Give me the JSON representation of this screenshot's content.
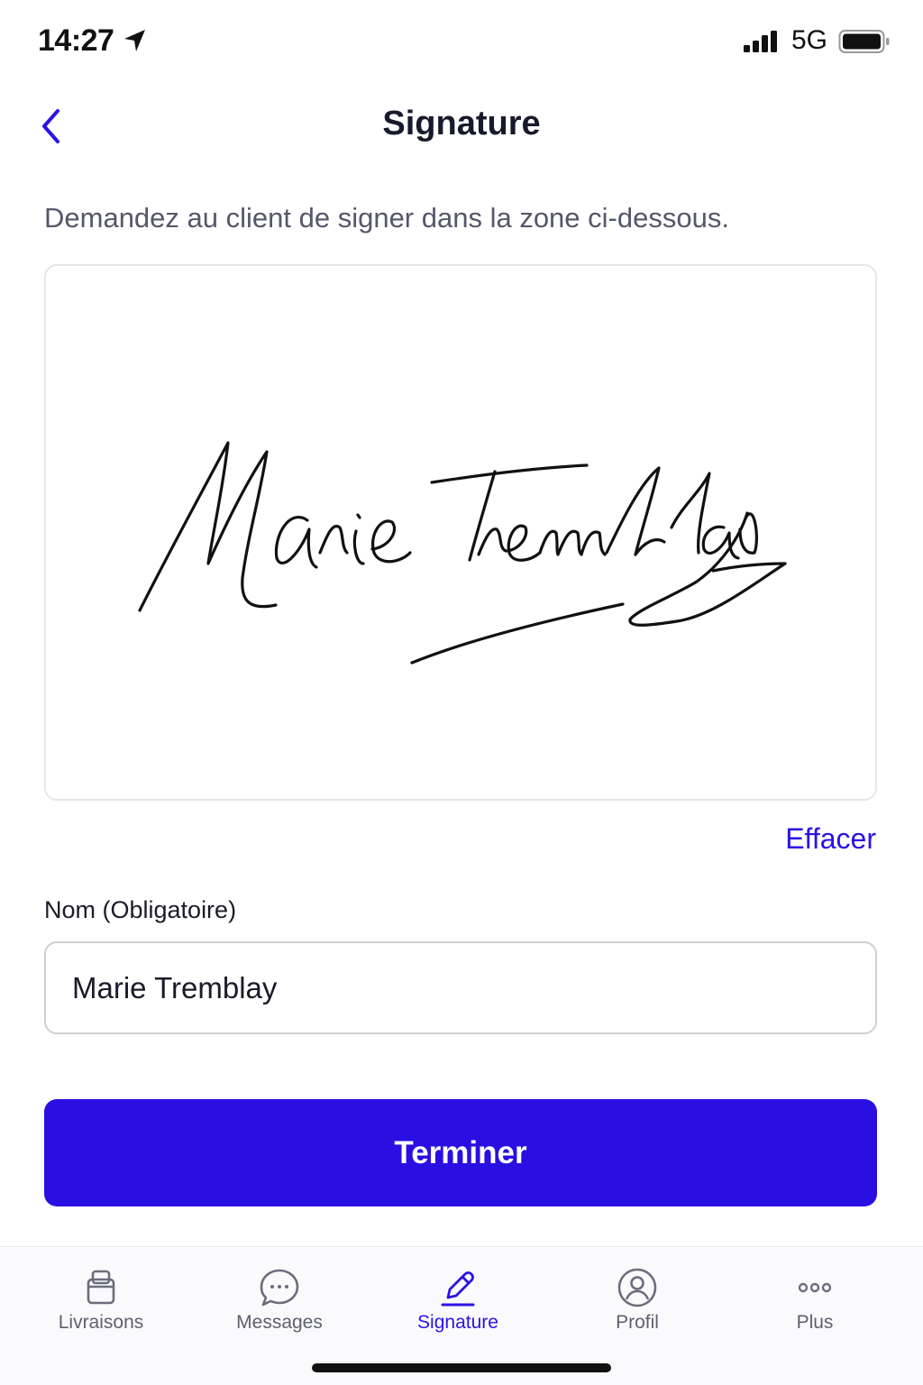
{
  "status_bar": {
    "time": "14:27",
    "network": "5G",
    "icons": [
      "location-arrow-icon",
      "cellular-signal-icon",
      "battery-icon"
    ]
  },
  "nav": {
    "title": "Signature",
    "back_icon": "chevron-left-icon"
  },
  "instruction": "Demandez au client de signer dans la zone ci-dessous.",
  "signature_pad": {
    "signed_name": "Marie Tremblay",
    "clear_label": "Effacer"
  },
  "name_field": {
    "label": "Nom (Obligatoire)",
    "value": "Marie Tremblay"
  },
  "primary_button": {
    "label": "Terminer"
  },
  "tab_bar": {
    "items": [
      {
        "label": "Livraisons",
        "icon": "package-icon",
        "active": false
      },
      {
        "label": "Messages",
        "icon": "chat-bubble-icon",
        "active": false
      },
      {
        "label": "Signature",
        "icon": "pen-icon",
        "active": true
      },
      {
        "label": "Profil",
        "icon": "user-circle-icon",
        "active": false
      },
      {
        "label": "Plus",
        "icon": "more-dots-icon",
        "active": false
      }
    ]
  },
  "colors": {
    "accent": "#2b12e6",
    "button_bg": "#2a0fe3",
    "text_dark": "#181a2c",
    "text_muted": "#55576a"
  }
}
